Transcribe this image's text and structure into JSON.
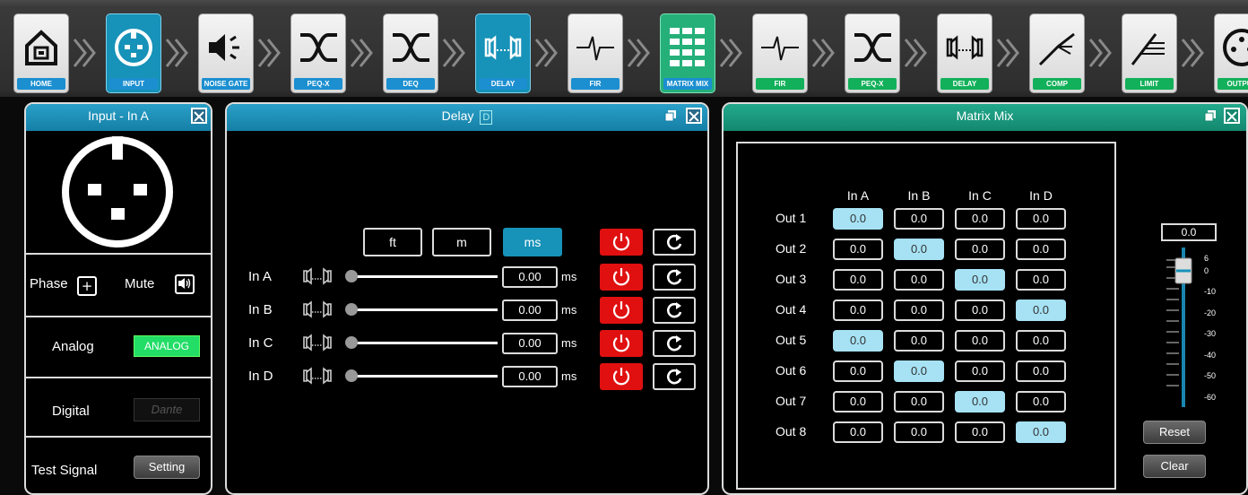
{
  "toolbar": {
    "items": [
      {
        "label": "HOME",
        "icon": "home-icon",
        "style": "plain"
      },
      {
        "label": "INPUT",
        "icon": "xlr-input-icon",
        "style": "active"
      },
      {
        "label": "NOISE GATE",
        "icon": "noise-gate-icon",
        "style": "plain"
      },
      {
        "label": "PEQ-X",
        "icon": "peq-x-icon",
        "style": "plain"
      },
      {
        "label": "DEQ",
        "icon": "deq-icon",
        "style": "plain"
      },
      {
        "label": "DELAY",
        "icon": "delay-icon",
        "style": "active"
      },
      {
        "label": "FIR",
        "icon": "fir-icon",
        "style": "plain"
      },
      {
        "label": "MATRIX MIX",
        "icon": "matrix-mix-icon",
        "style": "green"
      },
      {
        "label": "FIR",
        "icon": "fir-icon",
        "style": "plain"
      },
      {
        "label": "PEQ-X",
        "icon": "peq-x-icon",
        "style": "plain"
      },
      {
        "label": "DELAY",
        "icon": "delay-icon",
        "style": "plain"
      },
      {
        "label": "COMP",
        "icon": "comp-icon",
        "style": "plain"
      },
      {
        "label": "LIMIT",
        "icon": "limit-icon",
        "style": "plain"
      },
      {
        "label": "OUTPUT",
        "icon": "xlr-output-icon",
        "style": "plain"
      }
    ]
  },
  "input_panel": {
    "title": "Input - In A",
    "phase_label": "Phase",
    "phase_symbol": "+",
    "mute_label": "Mute",
    "analog_label": "Analog",
    "analog_button": "ANALOG",
    "digital_label": "Digital",
    "dante_logo": "Dante",
    "test_signal_label": "Test Signal",
    "setting_button": "Setting"
  },
  "delay_panel": {
    "title": "Delay",
    "title_badge": "D",
    "units": [
      "ft",
      "m",
      "ms"
    ],
    "active_unit": "ms",
    "channels": [
      {
        "name": "In A",
        "value": "0.00",
        "unit": "ms"
      },
      {
        "name": "In B",
        "value": "0.00",
        "unit": "ms"
      },
      {
        "name": "In C",
        "value": "0.00",
        "unit": "ms"
      },
      {
        "name": "In D",
        "value": "0.00",
        "unit": "ms"
      }
    ]
  },
  "matrix_panel": {
    "title": "Matrix Mix",
    "columns": [
      "In A",
      "In B",
      "In C",
      "In D"
    ],
    "rows": [
      {
        "name": "Out 1",
        "values": [
          "0.0",
          "0.0",
          "0.0",
          "0.0"
        ],
        "active": 0
      },
      {
        "name": "Out 2",
        "values": [
          "0.0",
          "0.0",
          "0.0",
          "0.0"
        ],
        "active": 1
      },
      {
        "name": "Out 3",
        "values": [
          "0.0",
          "0.0",
          "0.0",
          "0.0"
        ],
        "active": 2
      },
      {
        "name": "Out 4",
        "values": [
          "0.0",
          "0.0",
          "0.0",
          "0.0"
        ],
        "active": 3
      },
      {
        "name": "Out 5",
        "values": [
          "0.0",
          "0.0",
          "0.0",
          "0.0"
        ],
        "active": 0
      },
      {
        "name": "Out 6",
        "values": [
          "0.0",
          "0.0",
          "0.0",
          "0.0"
        ],
        "active": 1
      },
      {
        "name": "Out 7",
        "values": [
          "0.0",
          "0.0",
          "0.0",
          "0.0"
        ],
        "active": 2
      },
      {
        "name": "Out 8",
        "values": [
          "0.0",
          "0.0",
          "0.0",
          "0.0"
        ],
        "active": 3
      }
    ],
    "fader_value": "0.0",
    "fader_scale": [
      "6",
      "0",
      "-10",
      "-20",
      "-30",
      "-40",
      "-50",
      "-60"
    ],
    "reset_button": "Reset",
    "clear_button": "Clear"
  },
  "colors": {
    "accent_blue": "#1792b8",
    "matrix_green": "#13886e",
    "power_red": "#e01010",
    "analog_green": "#22dd66",
    "cell_highlight": "#a6e2f4"
  }
}
